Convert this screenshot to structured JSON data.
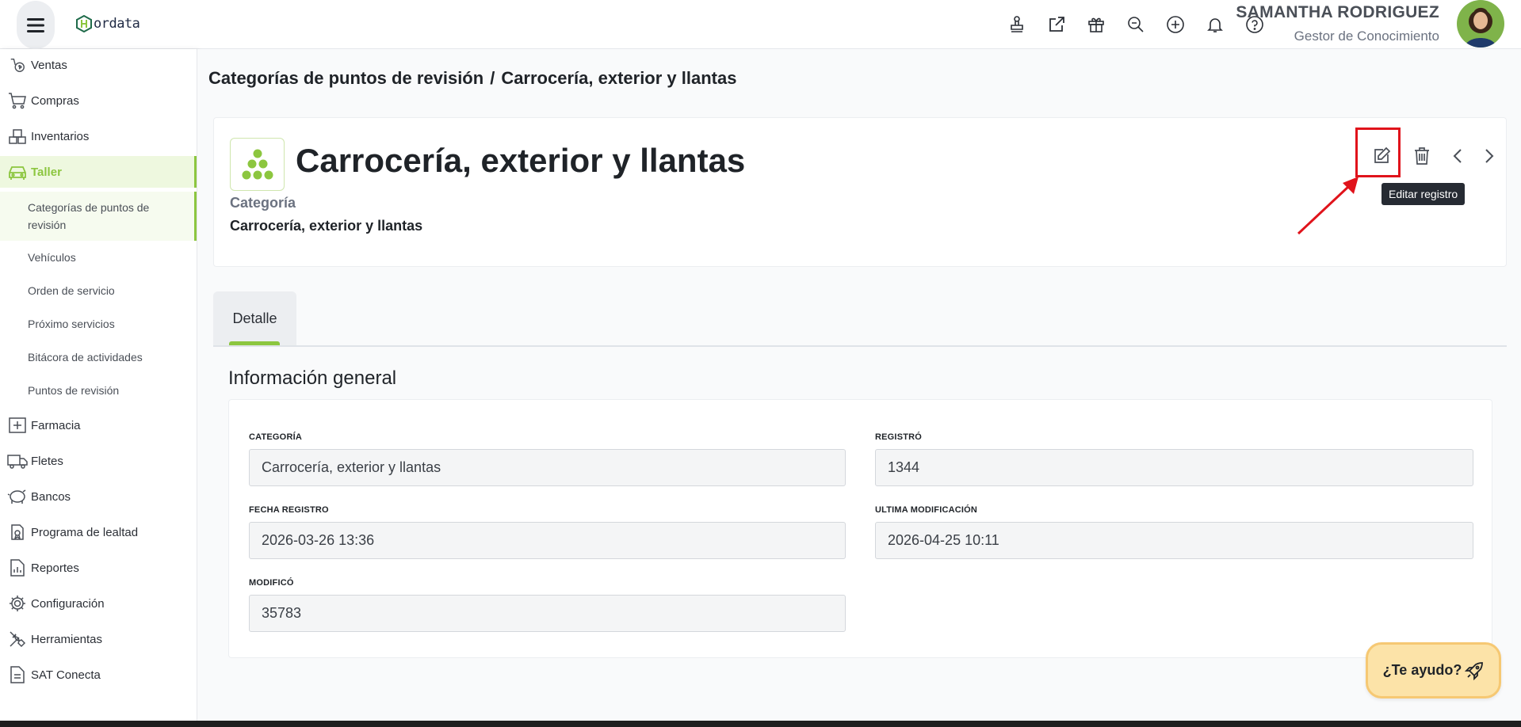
{
  "app": {
    "logo_text": "ordata"
  },
  "header": {
    "icons": [
      "stamp-icon",
      "external-link-icon",
      "gift-icon",
      "search-zoom-icon",
      "plus-circle-icon",
      "bell-icon",
      "help-icon"
    ],
    "user_name": "SAMANTHA RODRIGUEZ",
    "user_role": "Gestor de Conocimiento"
  },
  "sidebar": {
    "items": [
      {
        "label": "Ventas",
        "icon": "sales-icon"
      },
      {
        "label": "Compras",
        "icon": "cart-icon"
      },
      {
        "label": "Inventarios",
        "icon": "boxes-icon"
      },
      {
        "label": "Taller",
        "icon": "car-icon",
        "active": true
      },
      {
        "label": "Farmacia",
        "icon": "pharmacy-icon"
      },
      {
        "label": "Fletes",
        "icon": "truck-icon"
      },
      {
        "label": "Bancos",
        "icon": "piggy-bank-icon"
      },
      {
        "label": "Programa de lealtad",
        "icon": "loyalty-icon"
      },
      {
        "label": "Reportes",
        "icon": "report-icon"
      },
      {
        "label": "Configuración",
        "icon": "gear-icon"
      },
      {
        "label": "Herramientas",
        "icon": "tools-icon"
      },
      {
        "label": "SAT Conecta",
        "icon": "document-icon"
      }
    ],
    "taller_subitems": [
      "Categorías de puntos de revisión",
      "Vehículos",
      "Orden de servicio",
      "Próximo servicios",
      "Bitácora de actividades",
      "Puntos de revisión"
    ]
  },
  "breadcrumb": {
    "parent": "Categorías de puntos de revisión",
    "separator": "/",
    "current": "Carrocería, exterior y llantas"
  },
  "record": {
    "title": "Carrocería, exterior y llantas",
    "sub_label": "Categoría",
    "sub_value": "Carrocería, exterior y llantas",
    "tooltip": "Editar registro"
  },
  "tabs": [
    {
      "label": "Detalle",
      "active": true
    }
  ],
  "section": {
    "title": "Información general"
  },
  "form": {
    "categoria_label": "CATEGORÍA",
    "categoria_value": "Carrocería, exterior y llantas",
    "registro_label": "REGISTRÓ",
    "registro_value": "1344",
    "fecha_label": "FECHA REGISTRO",
    "fecha_value": "2026-03-26 13:36",
    "ultima_label": "ULTIMA MODIFICACIÓN",
    "ultima_value": "2026-04-25 10:11",
    "modifico_label": "MODIFICÓ",
    "modifico_value": "35783"
  },
  "help": {
    "label": "¿Te ayudo?"
  },
  "colors": {
    "accent": "#8cc63f",
    "highlight": "#e0131b",
    "help_bg": "#fce3a8"
  }
}
